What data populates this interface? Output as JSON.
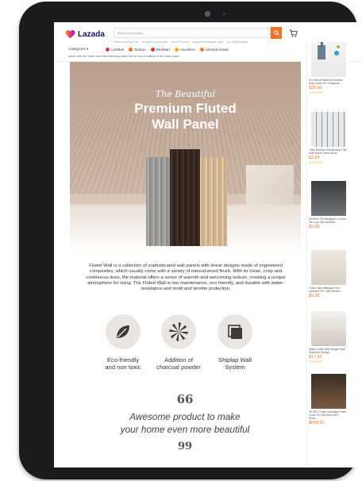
{
  "header": {
    "logo_text": "Lazada",
    "search_placeholder": "Search in Lazada",
    "suggestions": [
      "wheel mounting trunk",
      "bougain shoes power",
      "scs 2070 move",
      "strapper/mini/upsale strap",
      "vivo 1900/charger"
    ],
    "categories_label": "Categories",
    "nav_items": [
      {
        "label": "LazMall",
        "color": "#e62e78"
      },
      {
        "label": "Taobao",
        "color": "#f57224"
      },
      {
        "label": "RedMart",
        "color": "#e62e2e"
      },
      {
        "label": "Vouchers",
        "color": "#f5a623"
      },
      {
        "label": "Lifestyle Deals",
        "color": "#f07a3a"
      }
    ],
    "breadcrumb": "panel with the 3side slot end matching panel for the top or bottom of the main panel"
  },
  "banner": {
    "script_text": "The Beautiful",
    "title_line1": "Premium Fluted",
    "title_line2": "Wall Panel"
  },
  "description": "Fluted Wall is a collection of sophisticated wall panels with linear designs made of engineered composites, which usually come with a variety of natural wood finish. With its clean, crisp and continuous lines, the material offers a sense of warmth and welcoming texture, creating a unique atmosphere for living. The Fluted Wall is low maintenance, eco friendly, and durable with water-resistance and mold and termite protection.",
  "features": [
    {
      "line1": "Eco-friendly",
      "line2": "and non toxic",
      "icon": "leaf-icon"
    },
    {
      "line1": "Addition of",
      "line2": "charcoal powder",
      "icon": "spiral-icon"
    },
    {
      "line1": "Shiplap Wall",
      "line2": "System",
      "icon": "layers-icon"
    }
  ],
  "quote": {
    "open_mark": "66",
    "line1": "Awesome product to make",
    "line2": "your home even more beautiful",
    "close_mark": "99"
  },
  "recommendations": [
    {
      "name": "Eco Wheat Rabbit Air Bamboo Baby Green DIY Singapore...",
      "price": "$39.90",
      "stars": "★★★★★"
    },
    {
      "name": "Yotra 30x30cm Self Adhesive Tile Wall Sticker Home Decor...",
      "price": "$2.24",
      "stars": "★★★★★"
    },
    {
      "name": "30x30cm Tile Wallpaper Ceramic Tile Look Self Adhesive...",
      "price": "$2.99",
      "stars": ""
    },
    {
      "name": "Fresh Floral Wallpaper Self Adhesive PVC Wall Stickers...",
      "price": "$5.38",
      "stars": ""
    },
    {
      "name": "Space Cotton Wall Hanger Hook Organizer Storage...",
      "price": "$17.92",
      "stars": "★★★★★"
    },
    {
      "name": "3D WPC Fluted Laminated Panel Cover For 400x90cm WPC Wood...",
      "price": "$650.00",
      "stars": ""
    }
  ],
  "colors": {
    "brand": "#10156d",
    "accent": "#f57224",
    "price": "#f57224"
  }
}
